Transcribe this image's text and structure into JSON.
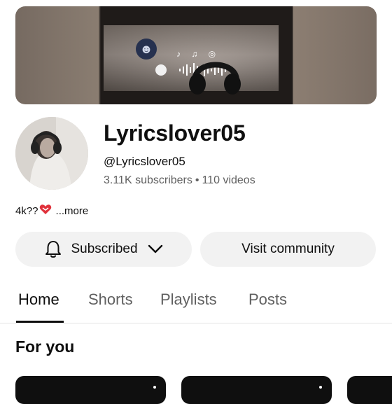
{
  "channel": {
    "name": "Lyricslover05",
    "handle": "@Lyricslover05",
    "subscribers": "3.11K subscribers",
    "separator": "•",
    "videos": "110 videos",
    "description": "4k??",
    "more_label": "...more"
  },
  "buttons": {
    "subscribed_label": "Subscribed",
    "community_label": "Visit community"
  },
  "tabs": [
    {
      "label": "Home",
      "active": true
    },
    {
      "label": "Shorts",
      "active": false
    },
    {
      "label": "Playlists",
      "active": false
    },
    {
      "label": "Posts",
      "active": false
    }
  ],
  "section": {
    "title": "For you"
  },
  "icons": [
    "bell-icon",
    "chevron-down-icon",
    "heart-icon",
    "more-vert-icon"
  ],
  "colors": {
    "text": "#0f0f0f",
    "secondary_text": "#606060",
    "button_bg": "#f2f2f2",
    "heart": "#e0313b"
  }
}
